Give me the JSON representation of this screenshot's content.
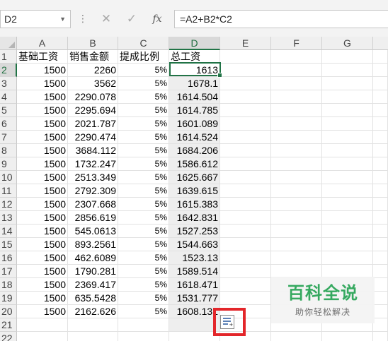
{
  "name_box": {
    "value": "D2"
  },
  "formula_bar": {
    "more_glyph": "⋮",
    "cancel_glyph": "✕",
    "enter_glyph": "✓",
    "fx_label": "fx",
    "formula": "=A2+B2*C2"
  },
  "columns": [
    "A",
    "B",
    "C",
    "D",
    "E",
    "F",
    "G"
  ],
  "selected_cell": "D2",
  "rows": [
    {
      "n": "1",
      "a": "基础工资",
      "b": "销售金额",
      "c": "提成比例",
      "d": "总工资"
    },
    {
      "n": "2",
      "a": "1500",
      "b": "2260",
      "c": "5%",
      "d": "1613"
    },
    {
      "n": "3",
      "a": "1500",
      "b": "3562",
      "c": "5%",
      "d": "1678.1"
    },
    {
      "n": "4",
      "a": "1500",
      "b": "2290.078",
      "c": "5%",
      "d": "1614.504"
    },
    {
      "n": "5",
      "a": "1500",
      "b": "2295.694",
      "c": "5%",
      "d": "1614.785"
    },
    {
      "n": "6",
      "a": "1500",
      "b": "2021.787",
      "c": "5%",
      "d": "1601.089"
    },
    {
      "n": "7",
      "a": "1500",
      "b": "2290.474",
      "c": "5%",
      "d": "1614.524"
    },
    {
      "n": "8",
      "a": "1500",
      "b": "3684.112",
      "c": "5%",
      "d": "1684.206"
    },
    {
      "n": "9",
      "a": "1500",
      "b": "1732.247",
      "c": "5%",
      "d": "1586.612"
    },
    {
      "n": "10",
      "a": "1500",
      "b": "2513.349",
      "c": "5%",
      "d": "1625.667"
    },
    {
      "n": "11",
      "a": "1500",
      "b": "2792.309",
      "c": "5%",
      "d": "1639.615"
    },
    {
      "n": "12",
      "a": "1500",
      "b": "2307.668",
      "c": "5%",
      "d": "1615.383"
    },
    {
      "n": "13",
      "a": "1500",
      "b": "2856.619",
      "c": "5%",
      "d": "1642.831"
    },
    {
      "n": "14",
      "a": "1500",
      "b": "545.0613",
      "c": "5%",
      "d": "1527.253"
    },
    {
      "n": "15",
      "a": "1500",
      "b": "893.2561",
      "c": "5%",
      "d": "1544.663"
    },
    {
      "n": "16",
      "a": "1500",
      "b": "462.6089",
      "c": "5%",
      "d": "1523.13"
    },
    {
      "n": "17",
      "a": "1500",
      "b": "1790.281",
      "c": "5%",
      "d": "1589.514"
    },
    {
      "n": "18",
      "a": "1500",
      "b": "2369.417",
      "c": "5%",
      "d": "1618.471"
    },
    {
      "n": "19",
      "a": "1500",
      "b": "635.5428",
      "c": "5%",
      "d": "1531.777"
    },
    {
      "n": "20",
      "a": "1500",
      "b": "2162.626",
      "c": "5%",
      "d": "1608.131"
    },
    {
      "n": "21",
      "a": "",
      "b": "",
      "c": "",
      "d": ""
    },
    {
      "n": "22",
      "a": "",
      "b": "",
      "c": "",
      "d": ""
    }
  ],
  "quick_analysis": {
    "icon": "quick-analysis-icon",
    "highlight_color": "#e3262a"
  },
  "watermark": {
    "title": "百科全说",
    "subtitle": "助你轻松解决"
  },
  "colors": {
    "accent": "#217346",
    "watermark_green": "#2ea65a"
  }
}
